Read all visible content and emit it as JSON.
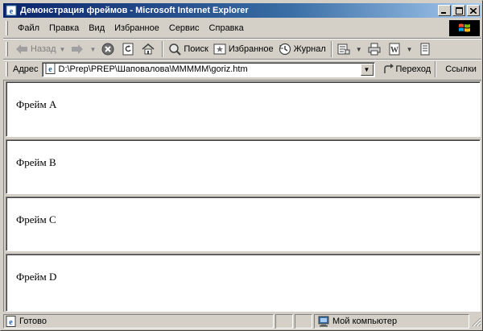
{
  "window": {
    "title": "Демонстрация фреймов - Microsoft Internet Explorer",
    "buttons": {
      "minimize": "_",
      "maximize": "□",
      "close": "✕"
    }
  },
  "menu": {
    "items": [
      {
        "label": "Файл"
      },
      {
        "label": "Правка"
      },
      {
        "label": "Вид"
      },
      {
        "label": "Избранное"
      },
      {
        "label": "Сервис"
      },
      {
        "label": "Справка"
      }
    ]
  },
  "toolbar": {
    "back_label": "Назад",
    "search_label": "Поиск",
    "favorites_label": "Избранное",
    "history_label": "Журнал"
  },
  "address": {
    "label": "Адрес",
    "url": "D:\\Prep\\PREP\\Шаповалова\\MMMMM\\goriz.htm",
    "go_label": "Переход",
    "links_label": "Ссылки"
  },
  "frames": [
    {
      "text": "Фрейм A"
    },
    {
      "text": "Фрейм B"
    },
    {
      "text": "Фрейм C"
    },
    {
      "text": "Фрейм D"
    }
  ],
  "status": {
    "text": "Готово",
    "zone": "Мой компьютер"
  },
  "colors": {
    "titlebar_start": "#0a246a",
    "titlebar_end": "#a6caf0",
    "face": "#d4d0c8"
  }
}
